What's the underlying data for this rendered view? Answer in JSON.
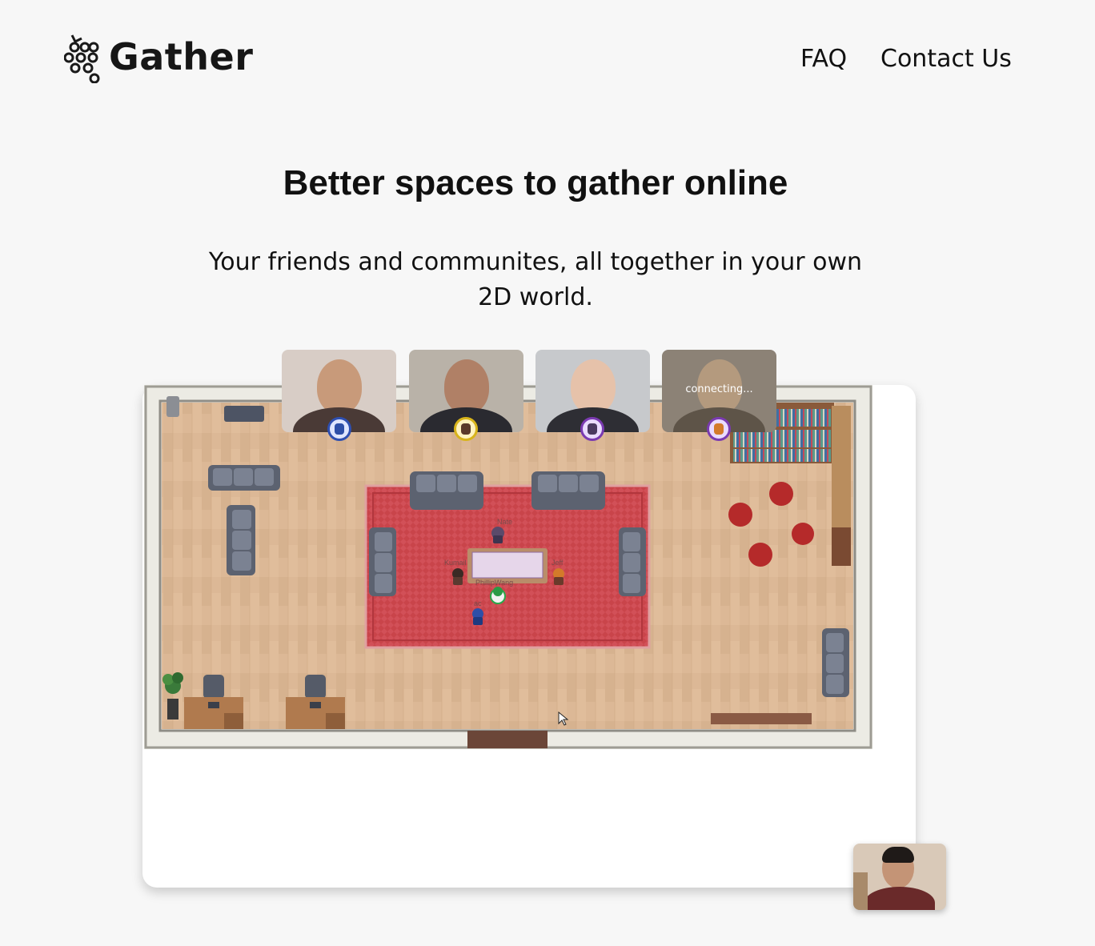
{
  "brand": {
    "name": "Gather"
  },
  "nav": {
    "faq": "FAQ",
    "contact": "Contact Us"
  },
  "hero": {
    "title": "Better spaces to gather online",
    "subtitle": "Your friends and communites, all together in your own 2D world."
  },
  "video_tiles": [
    {
      "status": ""
    },
    {
      "status": ""
    },
    {
      "status": ""
    },
    {
      "status": "connecting..."
    }
  ],
  "map": {
    "player_names": [
      "Nate",
      "Kumail",
      "Jeff",
      "PhillipWang",
      "ac"
    ]
  },
  "colors": {
    "background": "#f7f7f7",
    "floor": "#dcb896",
    "rug": "#c9444a",
    "wall": "#ecebe4",
    "sofa": "#5c6270"
  }
}
